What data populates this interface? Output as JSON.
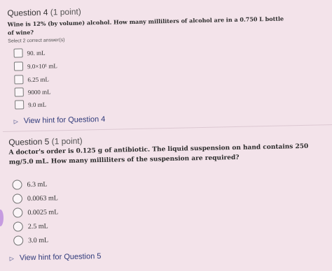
{
  "q4": {
    "title": "Question 4",
    "points": "(1 point)",
    "text_line1": "Wine is 12% (by volume) alcohol. How many milliliters of alcohol are in a 0.750 L bottle",
    "text_line2": "of wine?",
    "select_note": "Select 2 correct answer(s)",
    "options": [
      {
        "label": "90. mL"
      },
      {
        "label": "9.0×10¹ mL"
      },
      {
        "label": "6.25 mL"
      },
      {
        "label": "9000 mL"
      },
      {
        "label": "9.0 mL"
      }
    ],
    "hint": "View hint for Question 4"
  },
  "q5": {
    "title": "Question 5",
    "points": "(1 point)",
    "text_line1": "A doctor's order is 0.125 g of antibiotic. The liquid suspension on hand contains 250",
    "text_line2": "mg/5.0 mL. How many milliliters of the suspension are required?",
    "options": [
      {
        "label": "6.3 mL"
      },
      {
        "label": "0.0063 mL"
      },
      {
        "label": "0.0025 mL"
      },
      {
        "label": "2.5 mL"
      },
      {
        "label": "3.0 mL"
      }
    ],
    "hint": "View hint for Question 5"
  },
  "icons": {
    "hint_toggle": "triangle-right-icon"
  }
}
